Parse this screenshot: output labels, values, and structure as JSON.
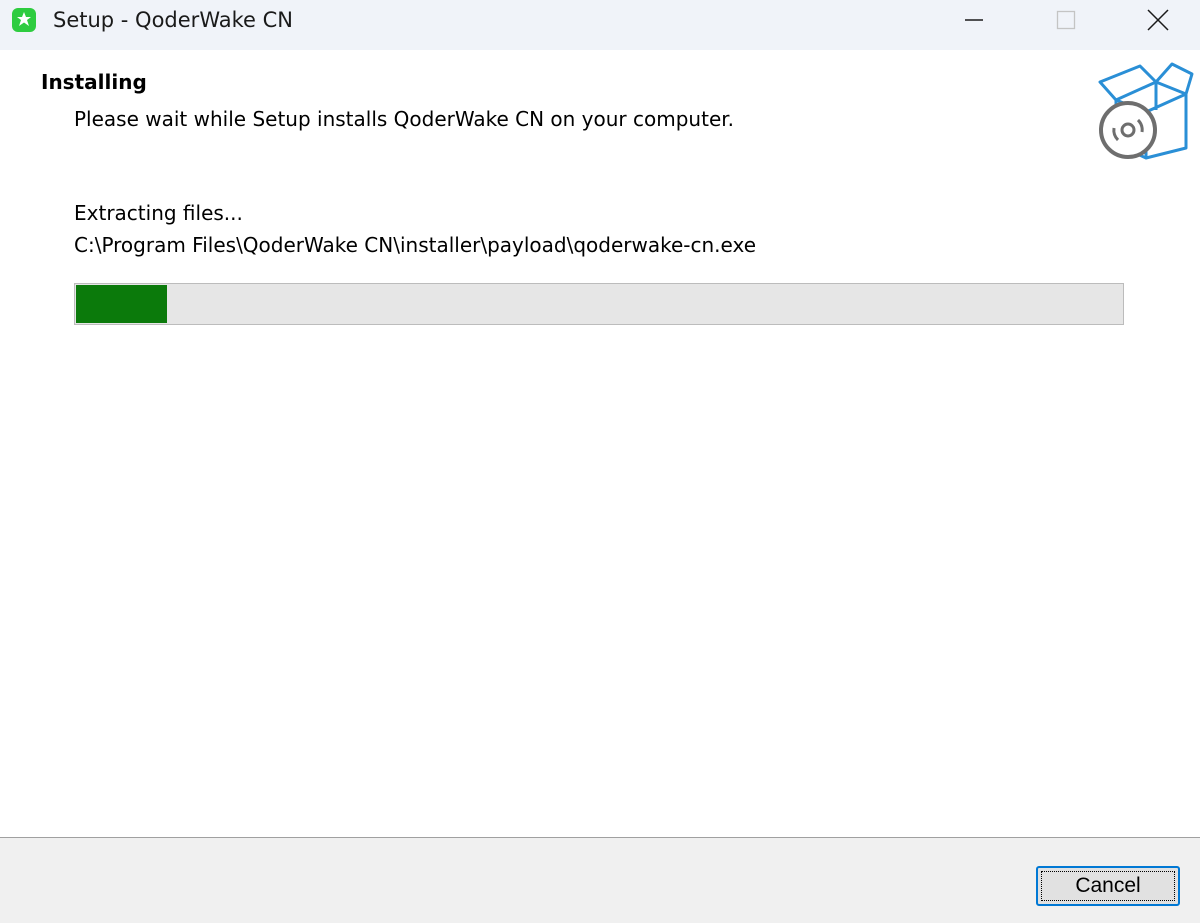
{
  "window": {
    "title": "Setup - QoderWake CN"
  },
  "header": {
    "heading": "Installing",
    "subheading": "Please wait while Setup installs QoderWake CN on your computer."
  },
  "body": {
    "status": "Extracting files...",
    "current_file": "C:\\Program Files\\QoderWake CN\\installer\\payload\\qoderwake-cn.exe",
    "progress_fraction": 0.087
  },
  "footer": {
    "cancel_label": "Cancel"
  },
  "colors": {
    "progress_fill": "#0b7a0b",
    "progress_track": "#e6e6e6",
    "focus_border": "#0078d4",
    "app_icon": "#2ecc40",
    "box_icon": "#2a8fd6"
  },
  "icons": {
    "app": "app-logo-icon",
    "minimize": "minimize-icon",
    "maximize": "maximize-icon",
    "close": "close-icon",
    "installer": "software-box-icon"
  }
}
